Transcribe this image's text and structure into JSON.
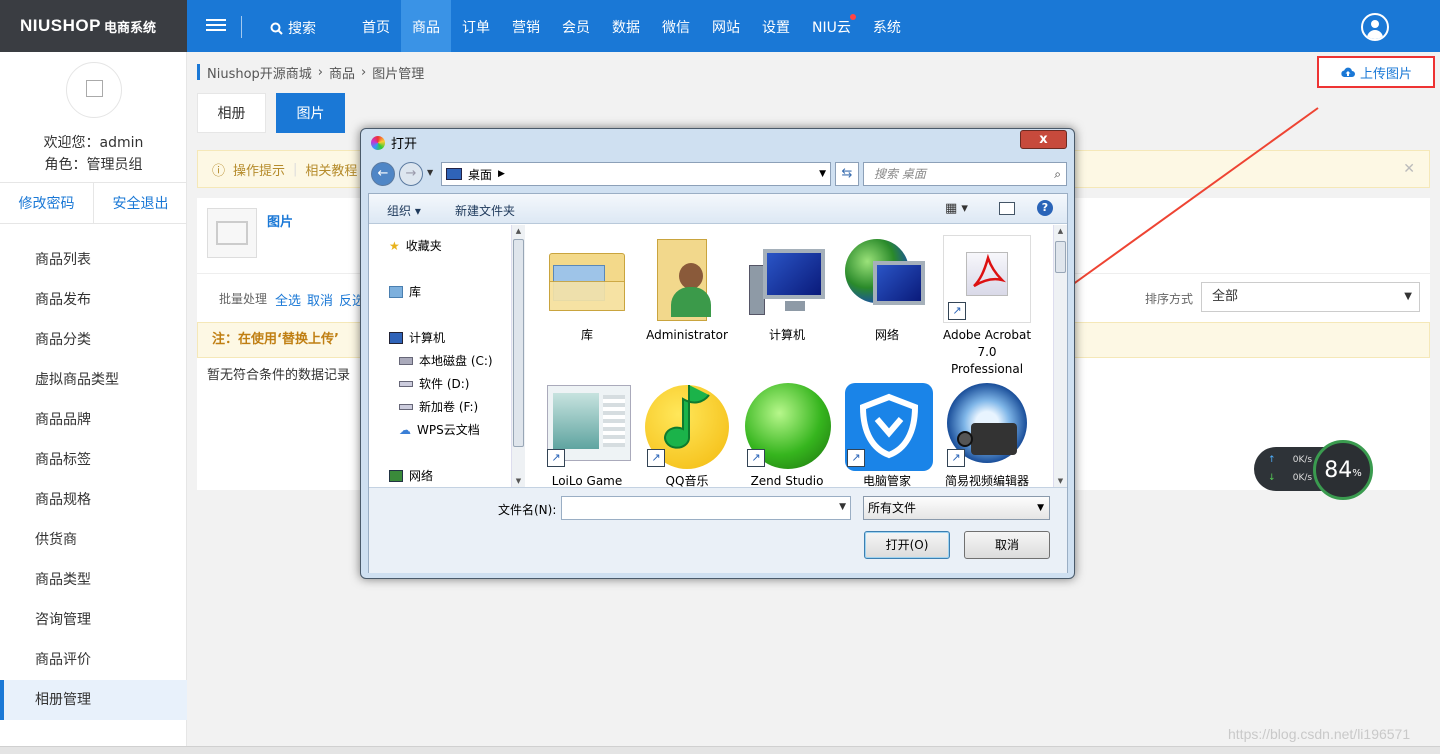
{
  "logo": {
    "brand": "NIUSHOP",
    "suffix": "电商系统"
  },
  "topnav": {
    "search_label": "搜索",
    "items": [
      "首页",
      "商品",
      "订单",
      "营销",
      "会员",
      "数据",
      "微信",
      "网站",
      "设置",
      "NIU云",
      "系统"
    ],
    "active": "商品"
  },
  "sidebar": {
    "welcome": "欢迎您：admin",
    "role": "角色：管理员组",
    "change_password": "修改密码",
    "logout": "安全退出",
    "items": [
      "商品列表",
      "商品发布",
      "商品分类",
      "虚拟商品类型",
      "商品品牌",
      "商品标签",
      "商品规格",
      "供货商",
      "商品类型",
      "咨询管理",
      "商品评价",
      "相册管理"
    ],
    "active": "相册管理"
  },
  "breadcrumb": [
    "Niushop开源商城",
    "商品",
    "图片管理"
  ],
  "upload_button": "上传图片",
  "tabs": [
    "相册",
    "图片"
  ],
  "tips": {
    "label": "操作提示",
    "text": "相关教程"
  },
  "panel": {
    "title": "图片",
    "batch_label": "批量处理",
    "select_all": "全选",
    "cancel": "取消",
    "invert": "反选",
    "sort_label": "排序方式",
    "sort_value": "全部",
    "note": "注：在使用‘替换上传’",
    "no_data": "暂无符合条件的数据记录"
  },
  "speed": {
    "up": "0K/s",
    "down": "0K/s",
    "percent": "84",
    "unit": "%"
  },
  "watermark": "https://blog.csdn.net/li196571",
  "dialog": {
    "title": "打开",
    "close": "x",
    "address": "桌面",
    "search_placeholder": "搜索 桌面",
    "organize": "组织",
    "new_folder": "新建文件夹",
    "tree": [
      "收藏夹",
      "库",
      "计算机",
      "本地磁盘 (C:)",
      "软件 (D:)",
      "新加卷 (F:)",
      "WPS云文档",
      "网络"
    ],
    "files": [
      {
        "name": "库"
      },
      {
        "name": "Administrator"
      },
      {
        "name": "计算机"
      },
      {
        "name": "网络"
      },
      {
        "name": "Adobe Acrobat 7.0 Professional"
      },
      {
        "name": "LoiLo Game"
      },
      {
        "name": "QQ音乐"
      },
      {
        "name": "Zend Studio"
      },
      {
        "name": "电脑管家"
      },
      {
        "name": "简易视频编辑器"
      }
    ],
    "filename_label": "文件名(N):",
    "filetype": "所有文件",
    "open_button": "打开(O)",
    "cancel_button": "取消"
  }
}
